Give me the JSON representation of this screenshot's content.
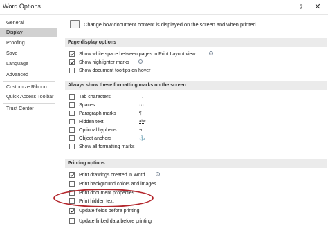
{
  "window": {
    "title": "Word Options",
    "help_glyph": "?",
    "close_glyph": "✕"
  },
  "sidebar": {
    "items": [
      {
        "label": "General",
        "selected": false
      },
      {
        "label": "Display",
        "selected": true
      },
      {
        "label": "Proofing",
        "selected": false
      },
      {
        "label": "Save",
        "selected": false
      },
      {
        "label": "Language",
        "selected": false
      },
      {
        "label": "Advanced",
        "selected": false
      },
      {
        "label": "Customize Ribbon",
        "selected": false
      },
      {
        "label": "Quick Access Toolbar",
        "selected": false
      },
      {
        "label": "Trust Center",
        "selected": false
      }
    ]
  },
  "intro": {
    "text": "Change how document content is displayed on the screen and when printed.",
    "icon": "display-options-icon"
  },
  "sections": {
    "page_display": {
      "title": "Page display options",
      "options": [
        {
          "label": "Show white space between pages in Print Layout view",
          "checked": true,
          "info": true
        },
        {
          "label": "Show highlighter marks",
          "checked": true,
          "info": true
        },
        {
          "label": "Show document tooltips on hover",
          "checked": false,
          "info": false
        }
      ]
    },
    "formatting_marks": {
      "title": "Always show these formatting marks on the screen",
      "options": [
        {
          "label": "Tab characters",
          "checked": false,
          "symbol": "→"
        },
        {
          "label": "Spaces",
          "checked": false,
          "symbol": "···"
        },
        {
          "label": "Paragraph marks",
          "checked": false,
          "symbol": "¶"
        },
        {
          "label": "Hidden text",
          "checked": false,
          "symbol": "abc"
        },
        {
          "label": "Optional hyphens",
          "checked": false,
          "symbol": "¬"
        },
        {
          "label": "Object anchors",
          "checked": false,
          "symbol": "⚓"
        },
        {
          "label": "Show all formatting marks",
          "checked": false,
          "symbol": ""
        }
      ]
    },
    "printing": {
      "title": "Printing options",
      "options": [
        {
          "label": "Print drawings created in Word",
          "checked": true,
          "info": true
        },
        {
          "label": "Print background colors and images",
          "checked": false,
          "info": false
        },
        {
          "label": "Print document properties",
          "checked": false,
          "info": false
        },
        {
          "label": "Print hidden text",
          "checked": false,
          "info": false
        },
        {
          "label": "Update fields before printing",
          "checked": true,
          "info": false
        },
        {
          "label": "Update linked data before printing",
          "checked": false,
          "info": false
        }
      ]
    }
  },
  "colors": {
    "annotation_ellipse": "#b3262c",
    "selected_nav": "#d1d1d1",
    "section_header_bg": "#ebebeb"
  }
}
